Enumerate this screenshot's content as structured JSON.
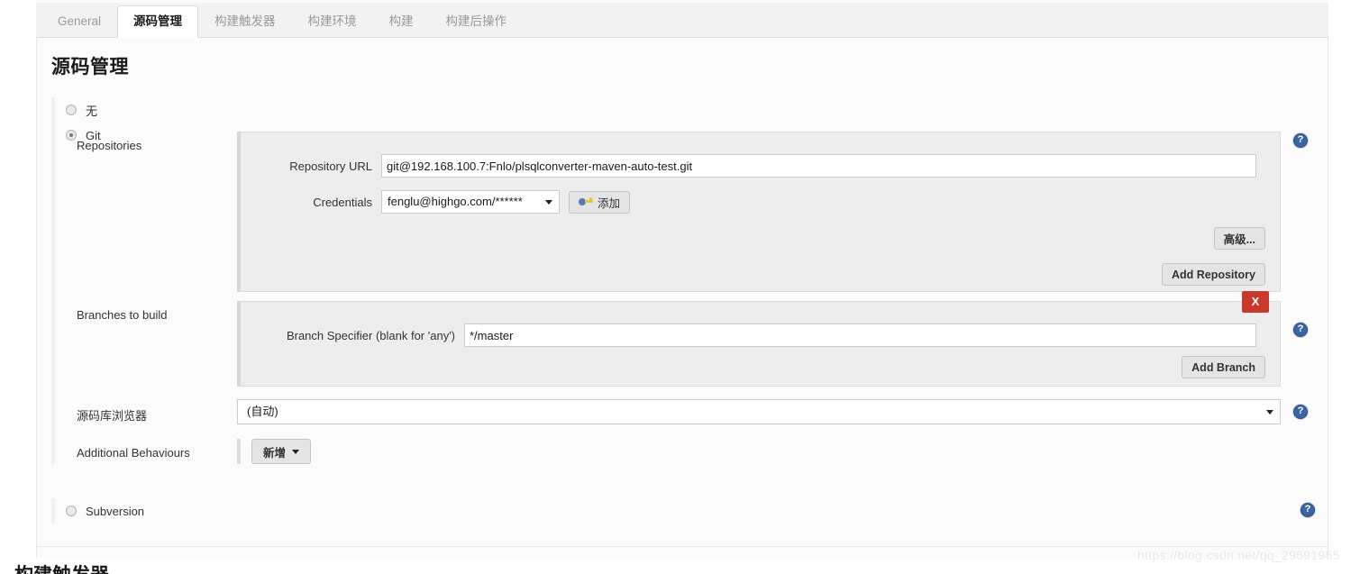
{
  "tabs": [
    {
      "label": "General",
      "active": false
    },
    {
      "label": "源码管理",
      "active": true
    },
    {
      "label": "构建触发器",
      "active": false
    },
    {
      "label": "构建环境",
      "active": false
    },
    {
      "label": "构建",
      "active": false
    },
    {
      "label": "构建后操作",
      "active": false
    }
  ],
  "page": {
    "title": "源码管理",
    "next_section_title": "构建触发器",
    "watermark": "https://blog.csdn.net/qq_29591955"
  },
  "scm_options": [
    {
      "label": "无",
      "checked": false
    },
    {
      "label": "Git",
      "checked": true
    },
    {
      "label": "Subversion",
      "checked": false
    }
  ],
  "git": {
    "repositories": {
      "label": "Repositories",
      "repository_url": {
        "label": "Repository URL",
        "value": "git@192.168.100.7:Fnlo/plsqlconverter-maven-auto-test.git"
      },
      "credentials": {
        "label": "Credentials",
        "selected": "fenglu@highgo.com/******",
        "add_button": "添加",
        "add_icon": "key-icon"
      },
      "advanced_button": "高级...",
      "add_repository_button": "Add Repository"
    },
    "branches": {
      "label": "Branches to build",
      "branch_specifier": {
        "label": "Branch Specifier (blank for 'any')",
        "value": "*/master"
      },
      "delete_button": "X",
      "add_branch_button": "Add Branch"
    },
    "repository_browser": {
      "label": "源码库浏览器",
      "selected": "(自动)"
    },
    "additional_behaviours": {
      "label": "Additional Behaviours",
      "add_button": "新增"
    }
  },
  "help_icons": {
    "glyph": "?",
    "color": "#3b65a1"
  }
}
